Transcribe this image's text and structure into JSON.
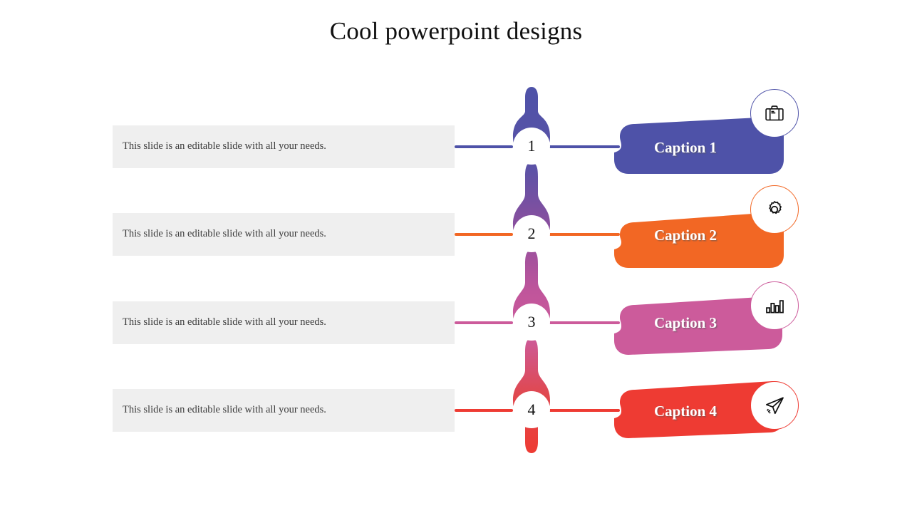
{
  "slide": {
    "title": "Cool powerpoint designs",
    "background_color": "#ffffff"
  },
  "rows": [
    {
      "number": "1",
      "description": "This slide is an editable slide with all your needs.",
      "caption": "Caption 1",
      "color": "#4E52A8",
      "icon": "briefcase-icon"
    },
    {
      "number": "2",
      "description": "This slide is an editable slide with all your needs.",
      "caption": "Caption 2",
      "color": "#F26724",
      "icon": "gear-icon"
    },
    {
      "number": "3",
      "description": "This slide is an editable slide with all your needs.",
      "caption": "Caption 3",
      "color": "#CC5B9B",
      "icon": "bar-chart-icon"
    },
    {
      "number": "4",
      "description": "This slide is an editable slide with all your needs.",
      "caption": "Caption 4",
      "color": "#EE3B33",
      "icon": "paper-plane-icon"
    }
  ],
  "palette": {
    "description_box_bg": "#efefef",
    "description_text": "#3b3b3b",
    "title_text": "#101010",
    "caption_text": "#ffffff",
    "spine_top": "#4E52A8",
    "spine_upper_mid": "#8A4F9E",
    "spine_lower_mid": "#CC5B9B",
    "spine_bottom": "#EE3B33"
  }
}
